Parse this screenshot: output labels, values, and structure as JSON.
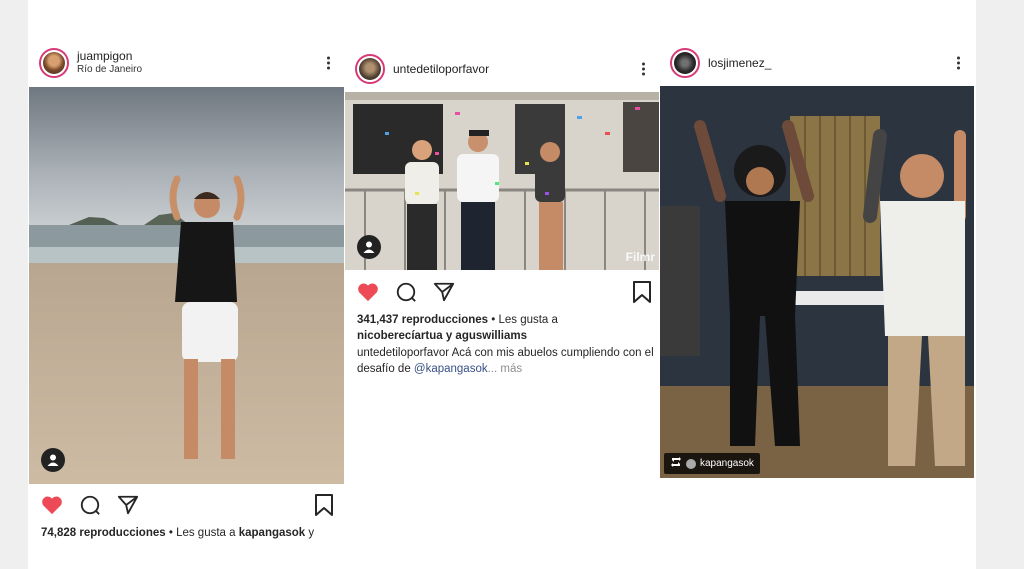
{
  "posts": [
    {
      "username": "juampigon",
      "location": "Río de Janeiro",
      "views": "74,828 reproducciones",
      "likes_prefix": " • Les gusta a ",
      "liked_by": "kapangasok",
      "likes_suffix": " y"
    },
    {
      "username": "untedetiloporfavor",
      "views": "341,437 reproducciones",
      "likes_prefix": " • Les gusta a",
      "liked_by": "nicoberecíartua y aguswilliams",
      "caption_user": "untedetiloporfavor",
      "caption_text": " Acá con mis abuelos cumpliendo con el desafío de ",
      "caption_mention": "@kapangasok",
      "caption_more": "... más",
      "watermark": "Filmr"
    },
    {
      "username": "losjimenez_",
      "repost_user": "kapangasok"
    }
  ],
  "icons": [
    "heart-icon",
    "comment-icon",
    "share-icon",
    "bookmark-icon",
    "more-icon",
    "user-tag-icon",
    "repost-icon"
  ],
  "colors": {
    "heart": "#ed4956",
    "link": "#385185",
    "ring": "#d63b78"
  }
}
